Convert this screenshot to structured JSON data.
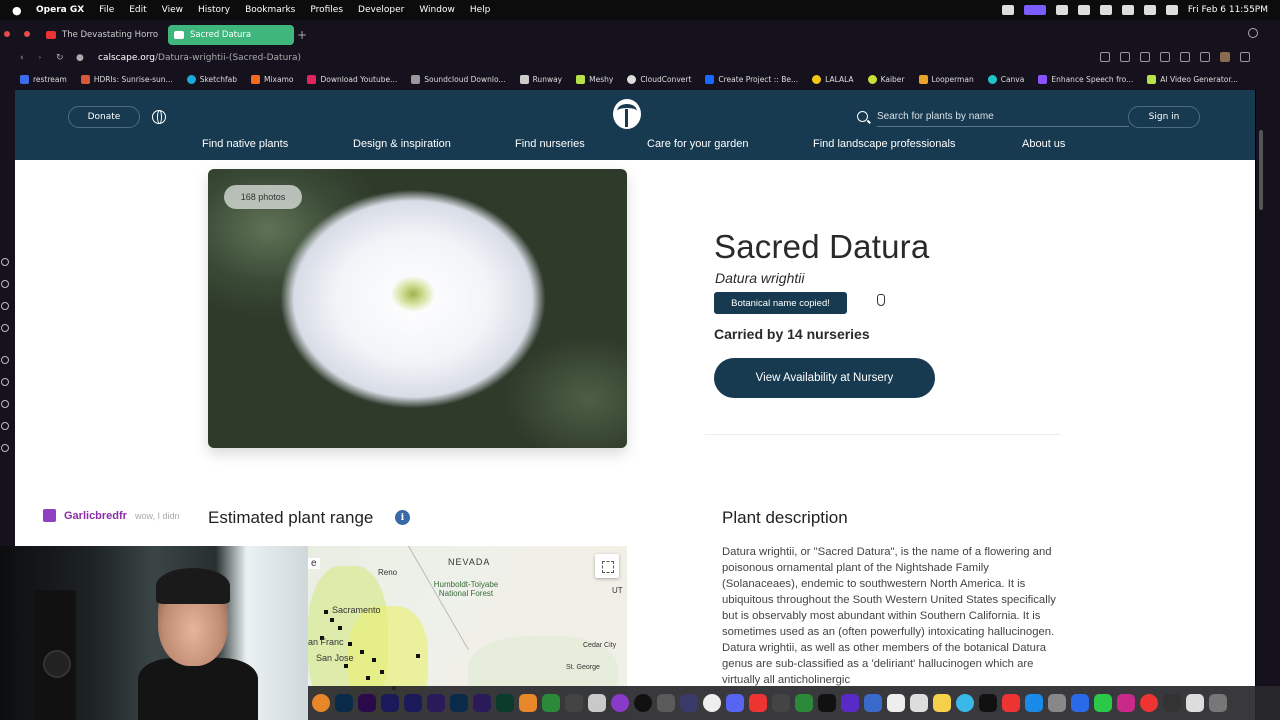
{
  "os_menubar": {
    "app_name": "Opera GX",
    "menus": [
      "File",
      "Edit",
      "View",
      "History",
      "Bookmarks",
      "Profiles",
      "Developer",
      "Window",
      "Help"
    ],
    "clock": "Fri Feb 6  11:55PM"
  },
  "browser": {
    "tabs": [
      {
        "label": "The Devastating Horro",
        "active": false
      },
      {
        "label": "Sacred Datura",
        "active": true
      }
    ],
    "url_domain": "calscape.org",
    "url_path": "/Datura-wrightii-(Sacred-Datura)",
    "bookmarks": [
      "restream",
      "HDRIs: Sunrise-sun...",
      "Sketchfab",
      "Mixamo",
      "Download Youtube...",
      "Soundcloud Downlo...",
      "Runway",
      "Meshy",
      "CloudConvert",
      "Create Project :: Be...",
      "LALALA",
      "Kaiber",
      "Looperman",
      "Canva",
      "Enhance Speech fro...",
      "AI Video Generator..."
    ]
  },
  "site": {
    "donate_label": "Donate",
    "search_placeholder": "Search for plants by name",
    "signin_label": "Sign in",
    "nav": [
      "Find native plants",
      "Design & inspiration",
      "Find nurseries",
      "Care for your garden",
      "Find landscape professionals",
      "About us"
    ]
  },
  "plant": {
    "photos_badge": "168 photos",
    "common_name": "Sacred Datura",
    "botanical_name": "Datura wrightii",
    "toast": "Botanical name copied!",
    "nurseries": "Carried by 14 nurseries",
    "availability_button": "View Availability at Nursery",
    "range_heading": "Estimated plant range",
    "description_heading": "Plant description",
    "description": "Datura wrightii, or \"Sacred Datura\", is the name of a flowering and poisonous ornamental plant of the Nightshade Family (Solanaceaes), endemic to southwestern North America. It is ubiquitous throughout the South Western United States specifically but is observably most abundant within Southern California. It is sometimes used as an (often powerfully) intoxicating hallucinogen. Datura wrightii, as well as other members of the botanical Datura genus are sub-classified as a 'deliriant' hallucinogen which are virtually all anticholinergic"
  },
  "map": {
    "labels": [
      "NEVADA",
      "Reno",
      "Humboldt-Toiyabe National Forest",
      "Sacramento",
      "San Jose",
      "UT",
      "Cedar City",
      "St. George",
      "an Franc",
      "e"
    ]
  },
  "chat": {
    "user": "Garlicbredfr",
    "message": "wow, I didn"
  },
  "colors": {
    "site_navy": "#173a50",
    "active_tab": "#3fb77c",
    "info_blue": "#3a6aa5"
  }
}
